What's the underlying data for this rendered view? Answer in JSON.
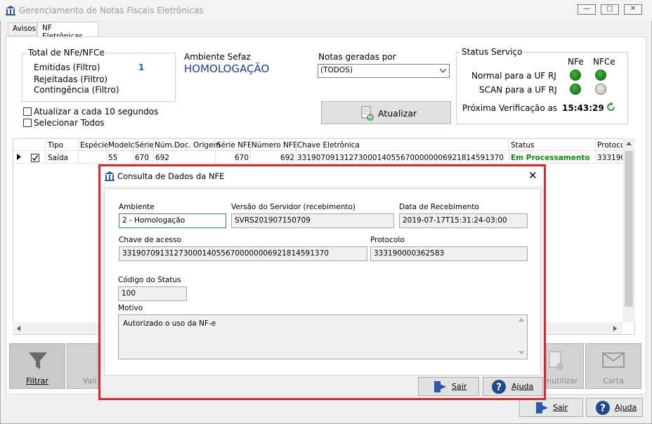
{
  "window": {
    "title": "Gerenciamento de Notas Fiscais Eletrônicas"
  },
  "tabs": [
    {
      "label": "Avisos"
    },
    {
      "label": "NF Eletrônicas"
    }
  ],
  "totals": {
    "legend": "Total de NFe/NFCe",
    "emitidas_label": "Emitidas (Filtro)",
    "emitidas_value": "1",
    "rejeitadas_label": "Rejeitadas (Filtro)",
    "contingencia_label": "Contingência (Filtro)"
  },
  "ambiente": {
    "label": "Ambiente Sefaz",
    "value": "HOMOLOGAÇÃO"
  },
  "notas": {
    "label": "Notas geradas por",
    "selected": "(TODOS)"
  },
  "options": {
    "atualizar_label": "Atualizar a cada 10 segundos",
    "selecionar_label": "Selecionar Todos"
  },
  "atualizar_button": "Atualizar",
  "status_servico": {
    "legend": "Status Serviço",
    "col_nfe": "NFe",
    "col_nfce": "NFCe",
    "normal_label": "Normal para a UF RJ",
    "scan_label": "SCAN para a UF RJ",
    "proxima_label": "Próxima Verificação as",
    "proxima_time": "15:43:29"
  },
  "grid": {
    "headers": [
      "Tipo",
      "Espécie",
      "Modelo",
      "Série",
      "Núm.Doc. Origem",
      "Série NFE",
      "Número NFE",
      "Chave Eletrônica",
      "Status",
      "Protoco"
    ],
    "row": {
      "tipo": "Saída",
      "especie": "",
      "modelo": "55",
      "serie": "670",
      "numdoc": "692",
      "serie_nfe": "670",
      "numero_nfe": "692",
      "chave": "33190709131273000140556700000006921814591370",
      "status": "Em Processamento",
      "protocolo": "333190"
    }
  },
  "toolbar": {
    "filtrar": "Filtrar",
    "validar": "Vali",
    "inutilizar": "nutilizar",
    "carta": "Carta"
  },
  "bottom": {
    "sair": "Sair",
    "ajuda": "Ajuda"
  },
  "dialog": {
    "title": "Consulta de Dados da NFE",
    "ambiente_label": "Ambiente",
    "ambiente_value": "2 - Homologação",
    "versao_label": "Versão do Servidor (recebimento)",
    "versao_value": "SVRS201907150709",
    "data_label": "Data de Recebimento",
    "data_value": "2019-07-17T15:31:24-03:00",
    "chave_label": "Chave de acesso",
    "chave_value": "33190709131273000140556700000006921814591370",
    "protocolo_label": "Protocolo",
    "protocolo_value": "333190000362583",
    "codigo_label": "Código do Status",
    "codigo_value": "100",
    "motivo_label": "Motivo",
    "motivo_value": "Autorizado o uso da NF-e",
    "sair": "Sair",
    "ajuda": "Ajuda"
  },
  "colors": {
    "status_green": "#0a8a0a",
    "accent_red": "#e0232e",
    "link_blue": "#1f5fae"
  }
}
